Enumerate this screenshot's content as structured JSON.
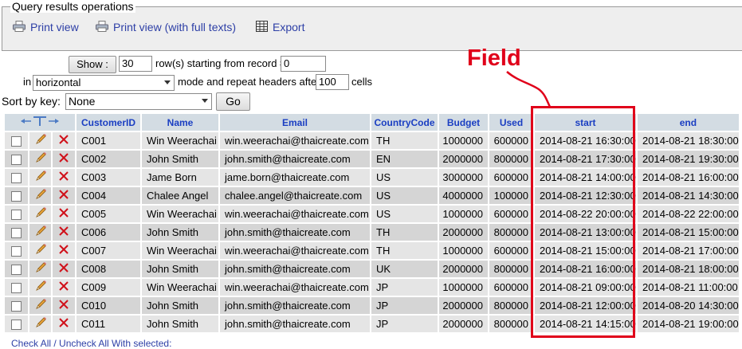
{
  "operations": {
    "legend": "Query results operations",
    "links": [
      {
        "label": "Print view",
        "icon": "printer-icon"
      },
      {
        "label": "Print view (with full texts)",
        "icon": "printer-icon"
      },
      {
        "label": "Export",
        "icon": "export-icon"
      }
    ]
  },
  "nav": {
    "show_label": "Show :",
    "rows_value": "30",
    "rows_text": "row(s) starting from record #",
    "start_value": "0",
    "in_label": "in",
    "mode_value": "horizontal",
    "mode_text": "mode and repeat headers after",
    "repeat_value": "100",
    "cells_text": "cells"
  },
  "sort": {
    "label": "Sort by key:",
    "value": "None",
    "go_label": "Go"
  },
  "table": {
    "columns": [
      "CustomerID",
      "Name",
      "Email",
      "CountryCode",
      "Budget",
      "Used",
      "start",
      "end"
    ],
    "rows": [
      [
        "C001",
        "Win Weerachai",
        "win.weerachai@thaicreate.com",
        "TH",
        "1000000",
        "600000",
        "2014-08-21 16:30:00",
        "2014-08-21 18:30:00"
      ],
      [
        "C002",
        "John Smith",
        "john.smith@thaicreate.com",
        "EN",
        "2000000",
        "800000",
        "2014-08-21 17:30:00",
        "2014-08-21 19:30:00"
      ],
      [
        "C003",
        "Jame Born",
        "jame.born@thaicreate.com",
        "US",
        "3000000",
        "600000",
        "2014-08-21 14:00:00",
        "2014-08-21 16:00:00"
      ],
      [
        "C004",
        "Chalee Angel",
        "chalee.angel@thaicreate.com",
        "US",
        "4000000",
        "100000",
        "2014-08-21 12:30:00",
        "2014-08-21 14:30:00"
      ],
      [
        "C005",
        "Win Weerachai",
        "win.weerachai@thaicreate.com",
        "US",
        "1000000",
        "600000",
        "2014-08-22 20:00:00",
        "2014-08-22 22:00:00"
      ],
      [
        "C006",
        "John Smith",
        "john.smith@thaicreate.com",
        "TH",
        "2000000",
        "800000",
        "2014-08-21 13:00:00",
        "2014-08-21 15:00:00"
      ],
      [
        "C007",
        "Win Weerachai",
        "win.weerachai@thaicreate.com",
        "TH",
        "1000000",
        "600000",
        "2014-08-21 15:00:00",
        "2014-08-21 17:00:00"
      ],
      [
        "C008",
        "John Smith",
        "john.smith@thaicreate.com",
        "UK",
        "2000000",
        "800000",
        "2014-08-21 16:00:00",
        "2014-08-21 18:00:00"
      ],
      [
        "C009",
        "Win Weerachai",
        "win.weerachai@thaicreate.com",
        "JP",
        "1000000",
        "600000",
        "2014-08-21 09:00:00",
        "2014-08-21 11:00:00"
      ],
      [
        "C010",
        "John Smith",
        "john.smith@thaicreate.com",
        "JP",
        "2000000",
        "800000",
        "2014-08-21 12:00:00",
        "2014-08-20 14:30:00"
      ],
      [
        "C011",
        "John Smith",
        "john.smith@thaicreate.com",
        "JP",
        "2000000",
        "800000",
        "2014-08-21 14:15:00",
        "2014-08-21 19:00:00"
      ]
    ]
  },
  "annotation": {
    "label": "Field",
    "color": "#e0001a"
  },
  "footer": {
    "text": "Check All / Uncheck All  With selected:"
  }
}
